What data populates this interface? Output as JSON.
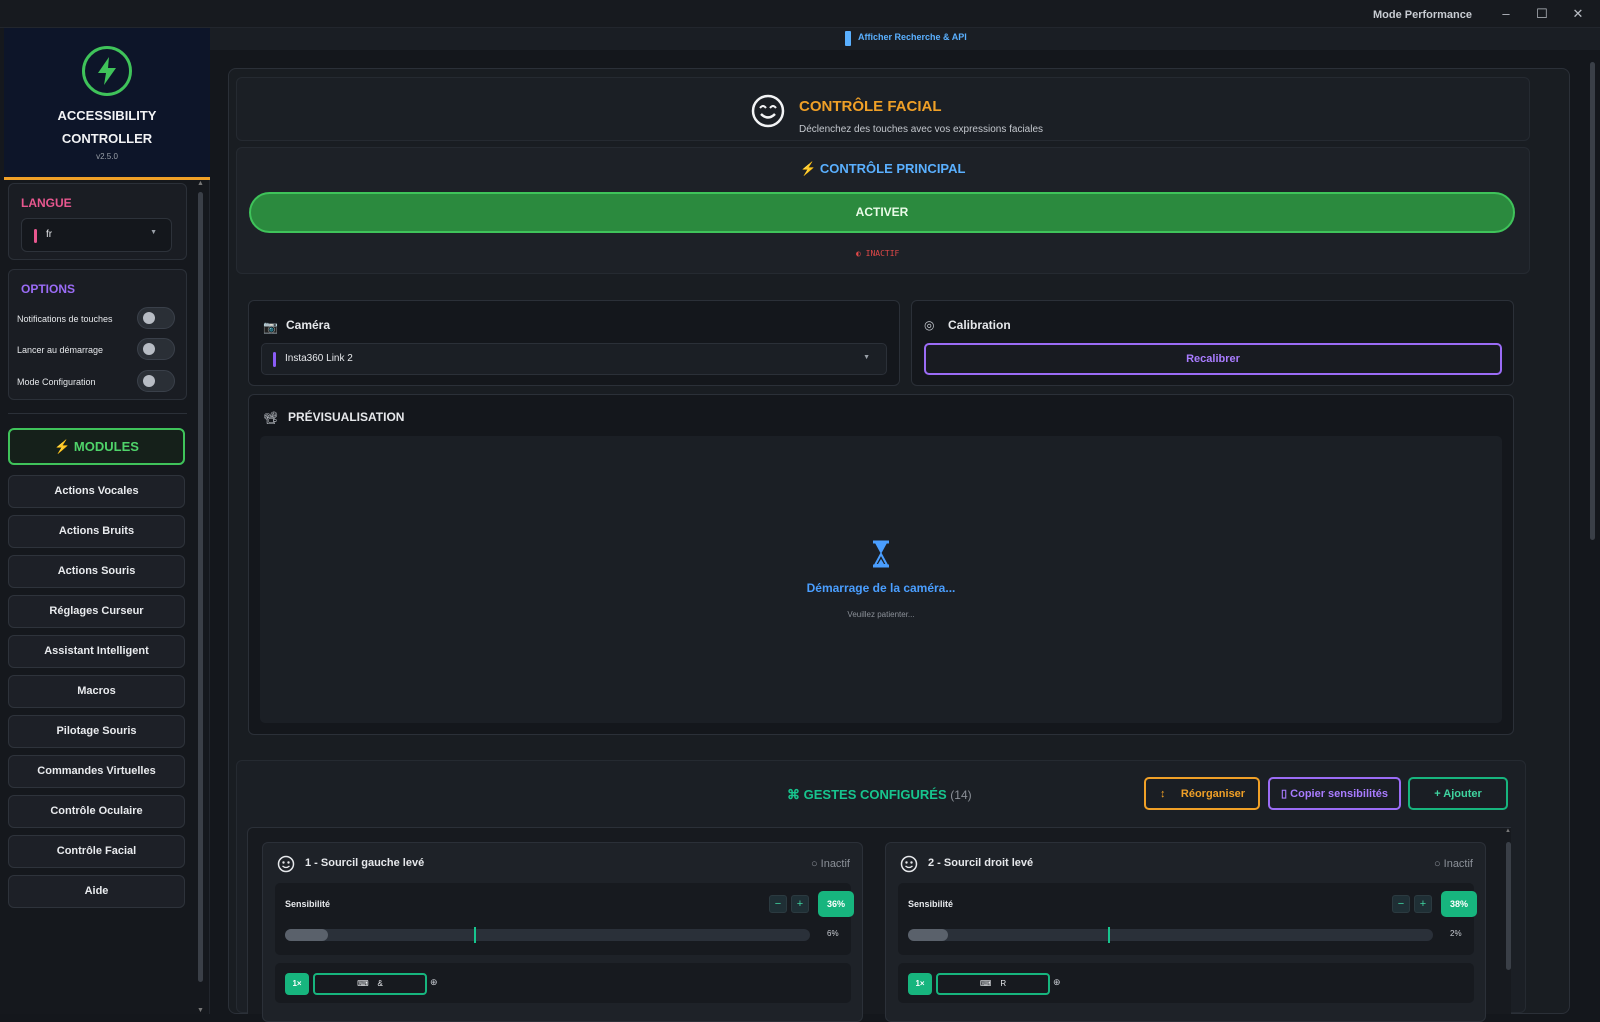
{
  "window": {
    "mode_label": "Mode Performance",
    "minimize": "–",
    "maximize": "☐",
    "close": "✕"
  },
  "brand": {
    "line1": "ACCESSIBILITY",
    "line2": "CONTROLLER",
    "version": "v2.5.0"
  },
  "language": {
    "title": "LANGUE",
    "value": "fr",
    "accent": "#e8578f"
  },
  "options": {
    "title": "OPTIONS",
    "items": [
      {
        "label": "Notifications de touches",
        "on": false
      },
      {
        "label": "Lancer au démarrage",
        "on": false
      },
      {
        "label": "Mode Configuration",
        "on": false
      }
    ]
  },
  "modules": {
    "title": "MODULES",
    "items": [
      "Actions Vocales",
      "Actions Bruits",
      "Actions Souris",
      "Réglages Curseur",
      "Assistant Intelligent",
      "Macros",
      "Pilotage Souris",
      "Commandes Virtuelles",
      "Contrôle Oculaire",
      "Contrôle Facial",
      "Aide"
    ]
  },
  "topbar": {
    "toggle_label": "Afficher Recherche & API"
  },
  "header": {
    "title": "CONTRÔLE FACIAL",
    "subtitle": "Déclenchez des touches avec vos expressions faciales"
  },
  "principal": {
    "title": "CONTRÔLE PRINCIPAL",
    "activate_label": "ACTIVER",
    "status": "INACTIF"
  },
  "camera": {
    "title": "Caméra",
    "selected": "Insta360 Link 2"
  },
  "calibration": {
    "title": "Calibration",
    "button": "Recalibrer"
  },
  "preview": {
    "title": "PRÉVISUALISATION",
    "loading": "Démarrage de la caméra...",
    "wait": "Veuillez patienter..."
  },
  "gestures": {
    "title": "GESTES CONFIGURÉS",
    "count": "(14)",
    "reorganize": "Réorganiser",
    "copy": "Copier sensibilités",
    "add": "+ Ajouter",
    "items": [
      {
        "name": "1 - Sourcil gauche levé",
        "status": "Inactif",
        "sensitivity_label": "Sensibilité",
        "sensitivity": "36%",
        "sensitivity_value": 0.36,
        "level": "6%",
        "level_value": 0.06,
        "repeat": "1×",
        "key": "&"
      },
      {
        "name": "2 - Sourcil droit levé",
        "status": "Inactif",
        "sensitivity_label": "Sensibilité",
        "sensitivity": "38%",
        "sensitivity_value": 0.38,
        "level": "2%",
        "level_value": 0.02,
        "repeat": "1×",
        "key": "R"
      }
    ]
  },
  "colors": {
    "accent_green": "#3fc35a",
    "accent_orange": "#f0a027",
    "accent_purple": "#9b6cf6",
    "accent_teal": "#17b57e",
    "accent_blue": "#5ab0ff",
    "status_red": "#e04848"
  }
}
